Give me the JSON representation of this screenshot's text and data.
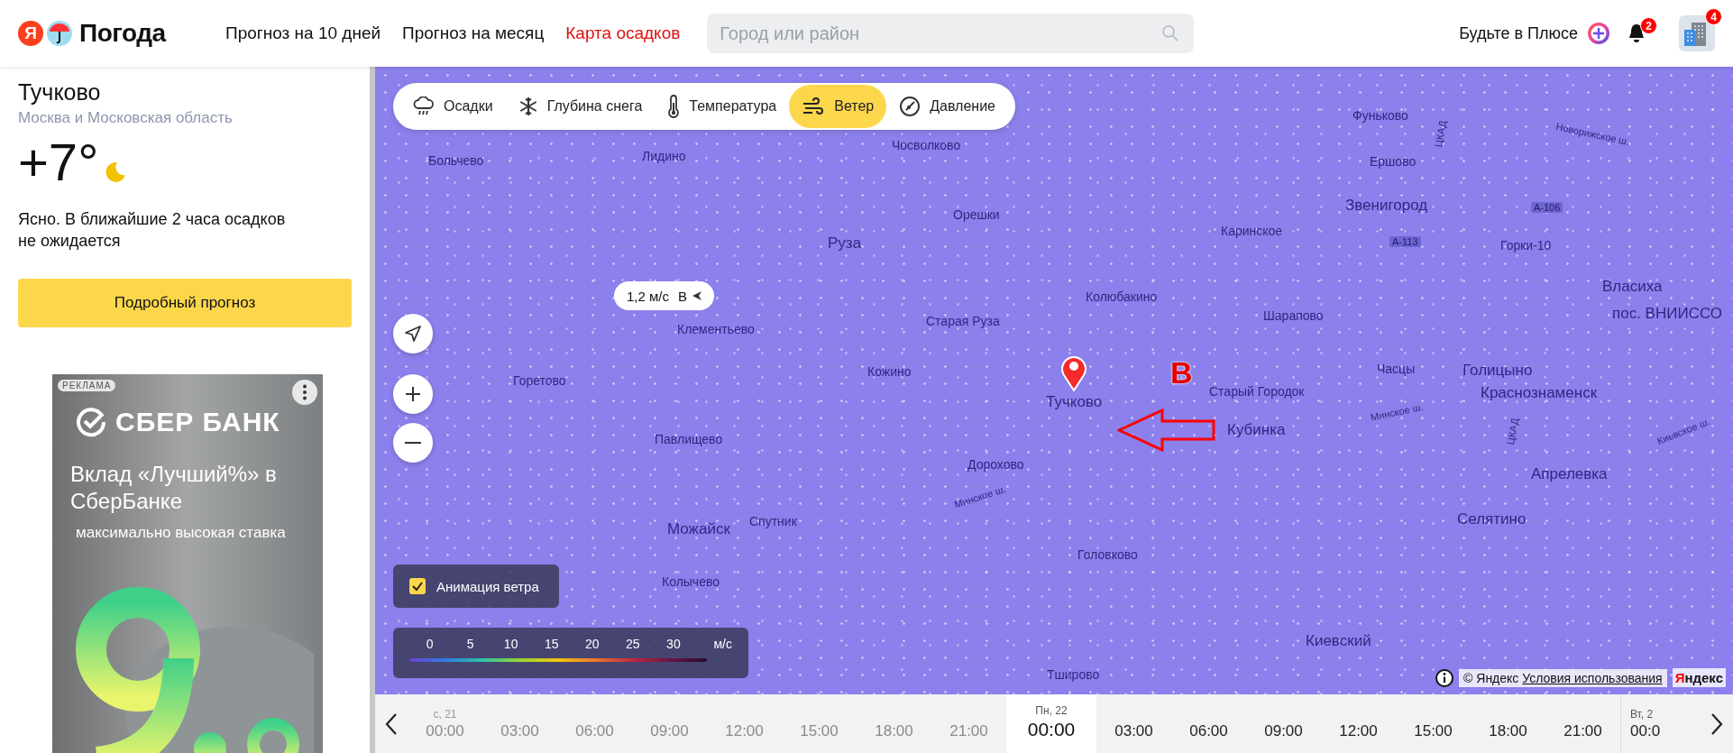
{
  "header": {
    "logo_letter": "Я",
    "logo_text": "Погода",
    "nav": [
      {
        "label": "Прогноз на 10 дней",
        "selected": false
      },
      {
        "label": "Прогноз на месяц",
        "selected": false
      },
      {
        "label": "Карта осадков",
        "selected": true
      }
    ],
    "search": {
      "placeholder": "Город или район"
    },
    "plus_label": "Будьте в Плюсе",
    "notifications_badge": "2",
    "account_badge": "4"
  },
  "sidebar": {
    "place": "Тучково",
    "region": "Москва и Московская область",
    "temperature": "+7°",
    "description": "Ясно. В ближайшие 2 часа осадков не ожидается",
    "forecast_button": "Подробный прогноз",
    "ad": {
      "label": "РЕКЛАМА",
      "brand": "СБЕР БАНК",
      "headline": "Вклад «Лучший%» в СберБанке",
      "subline": "максимально высокая ставка"
    }
  },
  "map": {
    "layers": [
      {
        "label": "Осадки",
        "kind": "rain",
        "selected": false
      },
      {
        "label": "Глубина снега",
        "kind": "snow",
        "selected": false
      },
      {
        "label": "Температура",
        "kind": "temperature",
        "selected": false
      },
      {
        "label": "Ветер",
        "kind": "wind",
        "selected": true
      },
      {
        "label": "Давление",
        "kind": "pressure",
        "selected": false
      }
    ],
    "tooltip": {
      "speed": "1,2 м/с",
      "direction": "В"
    },
    "places": [
      "Фуньково",
      "ЦКАД",
      "Новорижское ш.",
      "Чосволково",
      "Больчево",
      "Лидино",
      "Ершово",
      "Звенигород",
      "А-106",
      "Орешки",
      "Каринское",
      "Руза",
      "А-113",
      "Горки-10",
      "Власиха",
      "Колюбакино",
      "пос. ВНИИССО",
      "Шарапово",
      "Старая Руза",
      "Клементьево",
      "Горетово",
      "Кожино",
      "Часцы",
      "Голицыно",
      "Тучково",
      "Старый Городок",
      "Краснознаменск",
      "Павлищево",
      "Кубинка",
      "Минское ш.",
      "ЦКАД",
      "Киевское ш.",
      "Дорохово",
      "Апрелевка",
      "Минское ш.",
      "Селятино",
      "Спутник",
      "Можайск",
      "Головково",
      "Колычево",
      "Киевский",
      "Тширово"
    ],
    "annotation": "В",
    "wind_animation": {
      "label": "Анимация ветра",
      "checked": true
    },
    "legend": {
      "ticks": [
        "0",
        "5",
        "10",
        "15",
        "20",
        "25",
        "30"
      ],
      "unit": "м/с"
    },
    "attribution": {
      "copyright": "© Яндекс",
      "terms": "Условия использования",
      "logo_letter": "Я",
      "logo_text": "ндекс"
    }
  },
  "timeline": {
    "slots": [
      {
        "day": "с, 21",
        "time": "00:00",
        "kind": "past",
        "selected": false
      },
      {
        "time": "03:00",
        "kind": "past",
        "selected": false
      },
      {
        "time": "06:00",
        "kind": "past",
        "selected": false
      },
      {
        "time": "09:00",
        "kind": "past",
        "selected": false
      },
      {
        "time": "12:00",
        "kind": "past",
        "selected": false
      },
      {
        "time": "15:00",
        "kind": "past",
        "selected": false
      },
      {
        "time": "18:00",
        "kind": "past",
        "selected": false
      },
      {
        "time": "21:00",
        "kind": "past",
        "selected": false
      },
      {
        "day": "Пн, 22",
        "time": "00:00",
        "kind": "future",
        "selected": true
      },
      {
        "time": "03:00",
        "kind": "future",
        "selected": false
      },
      {
        "time": "06:00",
        "kind": "future",
        "selected": false
      },
      {
        "time": "09:00",
        "kind": "future",
        "selected": false
      },
      {
        "time": "12:00",
        "kind": "future",
        "selected": false
      },
      {
        "time": "15:00",
        "kind": "future",
        "selected": false
      },
      {
        "time": "18:00",
        "kind": "future",
        "selected": false
      },
      {
        "time": "21:00",
        "kind": "future",
        "selected": false
      },
      {
        "day": "Вт, 2",
        "time": "00:0",
        "kind": "future",
        "selected": false
      }
    ]
  }
}
